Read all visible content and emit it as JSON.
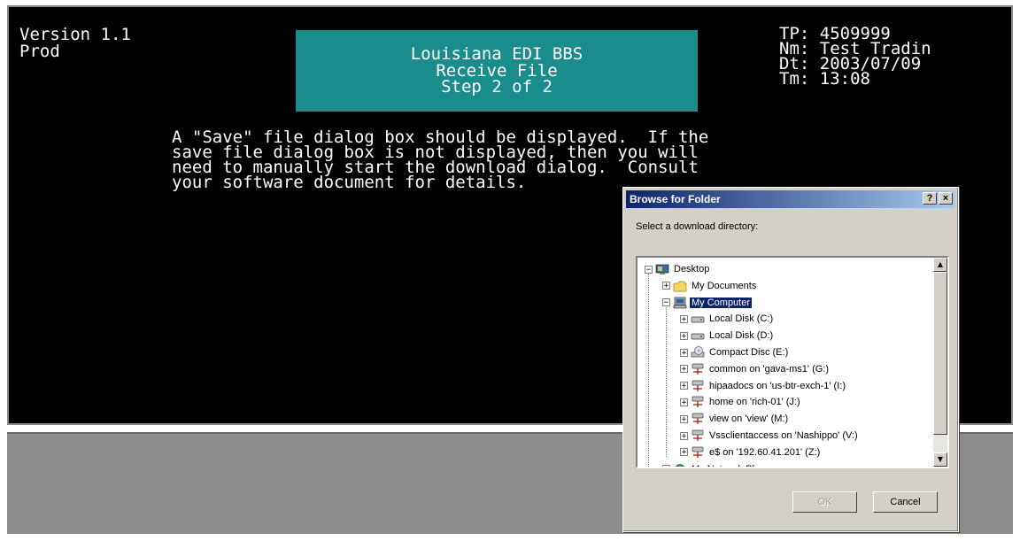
{
  "terminal": {
    "version_line1": "Version 1.1",
    "version_line2": "Prod",
    "banner": {
      "line1": "Louisiana EDI BBS",
      "line2": "Receive File",
      "line3": "Step 2 of 2",
      "color": "#1a8c8c"
    },
    "info": {
      "tp": "TP: 4509999",
      "nm": "Nm: Test Tradin",
      "dt": "Dt: 2003/07/09",
      "tm": "Tm: 13:08"
    },
    "message": [
      "A \"Save\" file dialog box should be displayed.  If the",
      "save file dialog box is not displayed, then you will",
      "need to manually start the download dialog.  Consult",
      "your software document for details."
    ]
  },
  "dialog": {
    "title": "Browse for Folder",
    "help_glyph": "?",
    "close_glyph": "×",
    "prompt": "Select a download directory:",
    "tree": [
      {
        "label": "Desktop",
        "icon": "desktop-icon",
        "level": 0,
        "expander": "−"
      },
      {
        "label": "My Documents",
        "icon": "folder-icon",
        "level": 1,
        "expander": "+"
      },
      {
        "label": "My Computer",
        "icon": "computer-icon",
        "level": 1,
        "expander": "−",
        "selected": true
      },
      {
        "label": "Local Disk (C:)",
        "icon": "drive-icon",
        "level": 2,
        "expander": "+"
      },
      {
        "label": "Local Disk (D:)",
        "icon": "drive-icon",
        "level": 2,
        "expander": "+"
      },
      {
        "label": "Compact Disc (E:)",
        "icon": "cd-icon",
        "level": 2,
        "expander": "+"
      },
      {
        "label": "common on 'gava-ms1' (G:)",
        "icon": "network-drive-icon",
        "level": 2,
        "expander": "+"
      },
      {
        "label": "hipaadocs on 'us-btr-exch-1' (I:)",
        "icon": "network-drive-icon",
        "level": 2,
        "expander": "+"
      },
      {
        "label": "home on 'rich-01' (J:)",
        "icon": "network-drive-icon",
        "level": 2,
        "expander": "+"
      },
      {
        "label": "view on 'view' (M:)",
        "icon": "network-drive-icon",
        "level": 2,
        "expander": "+"
      },
      {
        "label": "Vssclientaccess on 'Nashippo' (V:)",
        "icon": "network-drive-icon",
        "level": 2,
        "expander": "+"
      },
      {
        "label": "e$ on '192.60.41.201' (Z:)",
        "icon": "network-drive-icon",
        "level": 2,
        "expander": "+"
      },
      {
        "label": "My Network Places",
        "icon": "network-places-icon",
        "level": 1,
        "expander": "+"
      }
    ],
    "ok_label": "OK",
    "cancel_label": "Cancel"
  }
}
